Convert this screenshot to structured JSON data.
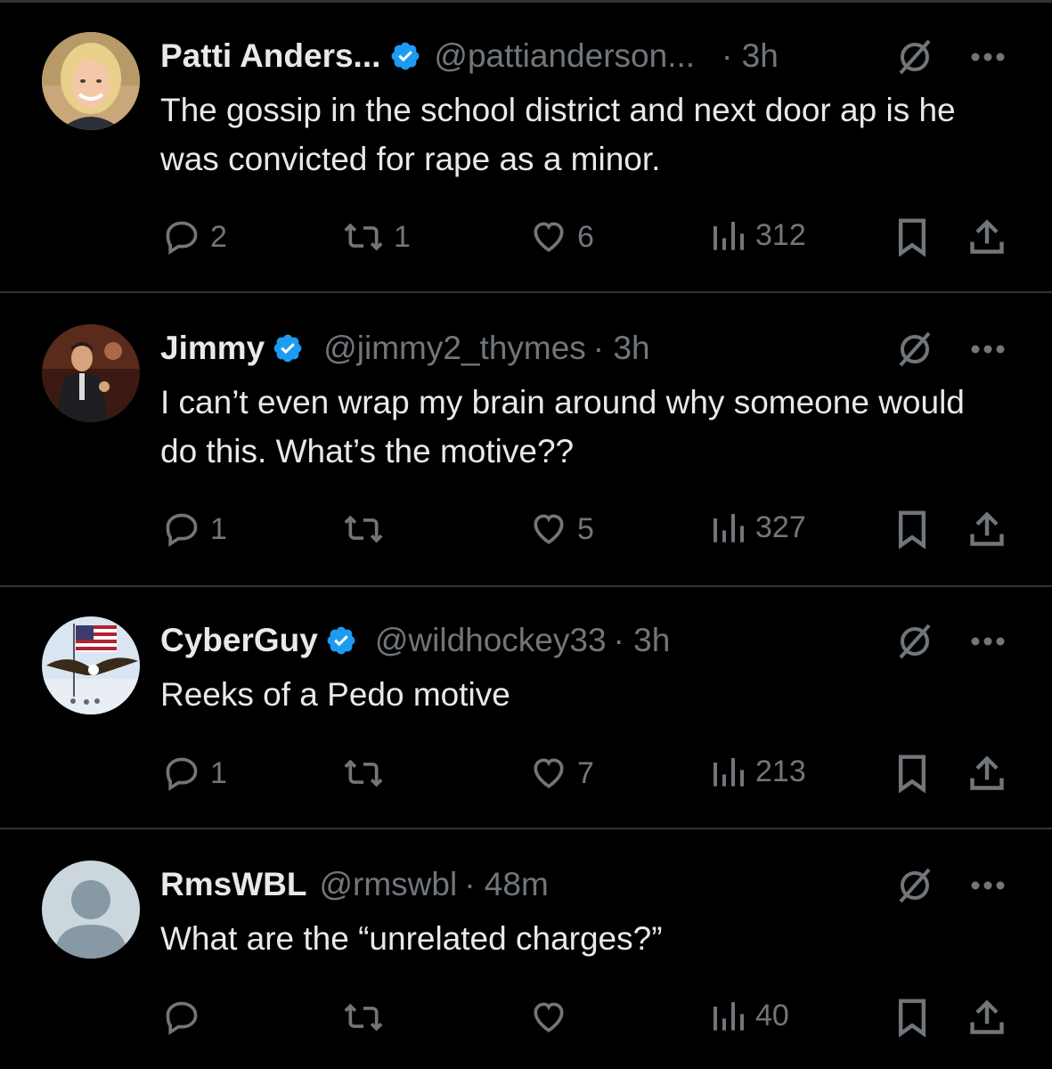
{
  "tweets": [
    {
      "name": "Patti Anders...",
      "handle": "@pattianderson...",
      "time": "· 3h",
      "text": "The gossip in the school district and next door ap is he was convicted for rape as a minor.",
      "replies": "2",
      "reposts": "1",
      "likes": "6",
      "views": "312",
      "verified": true,
      "avatar": "woman-blonde-avatar"
    },
    {
      "name": "Jimmy",
      "handle": "@jimmy2_thymes",
      "time": "· 3h",
      "text": "I can’t even wrap my brain around why someone would do this. What’s the motive??",
      "replies": "1",
      "reposts": "",
      "likes": "5",
      "views": "327",
      "verified": true,
      "avatar": "man-photo-avatar"
    },
    {
      "name": "CyberGuy",
      "handle": "@wildhockey33",
      "time": "· 3h",
      "text": "Reeks of a Pedo motive",
      "replies": "1",
      "reposts": "",
      "likes": "7",
      "views": "213",
      "verified": true,
      "avatar": "eagle-flag-avatar"
    },
    {
      "name": "RmsWBL",
      "handle": "@rmswbl",
      "time": "· 48m",
      "text": "What are the “unrelated charges?”",
      "replies": "",
      "reposts": "",
      "likes": "",
      "views": "40",
      "verified": false,
      "avatar": "default-avatar"
    }
  ],
  "colors": {
    "background": "#000000",
    "text": "#e7e9ea",
    "muted": "#71767b",
    "verified": "#1d9bf0",
    "divider": "#2f3336"
  }
}
